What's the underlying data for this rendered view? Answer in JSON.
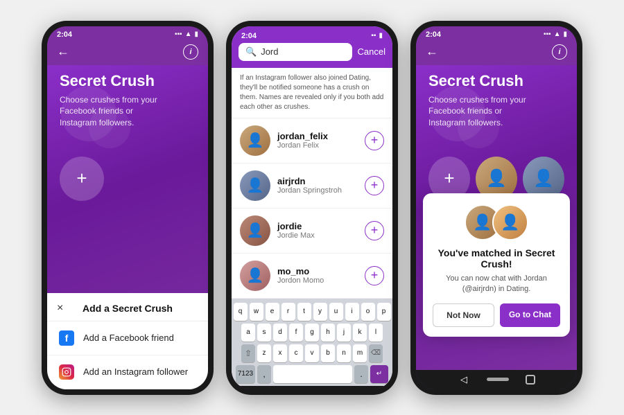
{
  "phone1": {
    "status_time": "2:04",
    "screen_title": "Secret Crush",
    "screen_subtitle": "Choose crushes from your Facebook friends or Instagram followers.",
    "bottom_sheet": {
      "title": "Add a Secret Crush",
      "close_icon": "×",
      "items": [
        {
          "label": "Add a Facebook friend",
          "icon_type": "facebook"
        },
        {
          "label": "Add an Instagram follower",
          "icon_type": "instagram"
        }
      ]
    }
  },
  "phone2": {
    "status_time": "2:04",
    "search": {
      "value": "Jord",
      "placeholder": "Search",
      "cancel_label": "Cancel"
    },
    "notice": "If an Instagram follower also joined Dating, they'll be notified someone has a crush on them. Names are revealed only if you both add each other as crushes.",
    "results": [
      {
        "username": "jordan_felix",
        "fullname": "Jordan Felix"
      },
      {
        "username": "airjrdn",
        "fullname": "Jordan Springstroh"
      },
      {
        "username": "jordie",
        "fullname": "Jordie Max"
      },
      {
        "username": "mo_mo",
        "fullname": "Jordon Momo"
      }
    ],
    "keyboard": {
      "rows": [
        [
          "q",
          "w",
          "e",
          "r",
          "t",
          "y",
          "u",
          "i",
          "o",
          "p"
        ],
        [
          "a",
          "s",
          "d",
          "f",
          "g",
          "h",
          "j",
          "k",
          "l"
        ],
        [
          "⇧",
          "z",
          "x",
          "c",
          "v",
          "b",
          "n",
          "m",
          "⌫"
        ]
      ],
      "bottom": [
        "7123",
        ",",
        "",
        ".",
        "↵"
      ]
    }
  },
  "phone3": {
    "status_time": "2:04",
    "screen_title": "Secret Crush",
    "screen_subtitle": "Choose crushes from your Facebook friends or Instagram followers.",
    "match_dialog": {
      "title": "You've matched in Secret Crush!",
      "description": "You can now chat with Jordan (@airjrdn) in Dating.",
      "btn_not_now": "Not Now",
      "btn_go_chat": "Go to Chat"
    }
  }
}
